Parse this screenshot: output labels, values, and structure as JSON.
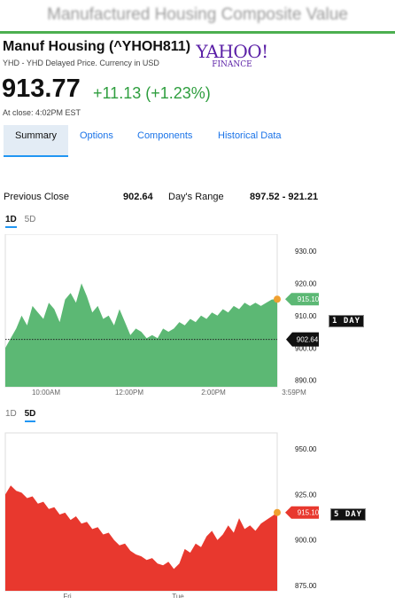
{
  "page_title": "Manufactured Housing Composite Value",
  "quote": {
    "name": "Manuf Housing (^YHOH811)",
    "subtitle": "YHD - YHD Delayed Price. Currency in USD",
    "price": "913.77",
    "change": "+11.13 (+1.23%)",
    "at_close": "At close: 4:02PM EST"
  },
  "logo": {
    "main": "YAHOO!",
    "sub": "FINANCE"
  },
  "tabs": [
    {
      "label": "Summary",
      "active": true
    },
    {
      "label": "Options",
      "active": false
    },
    {
      "label": "Components",
      "active": false
    },
    {
      "label": "Historical Data",
      "active": false
    }
  ],
  "stats": {
    "previous_close_label": "Previous Close",
    "previous_close_value": "902.64",
    "days_range_label": "Day's Range",
    "days_range_value": "897.52 - 921.21"
  },
  "colors": {
    "up": "#5cb874",
    "down": "#e8382e",
    "marker": "#f0a030",
    "accent": "#2196f3"
  },
  "chart_data": [
    {
      "type": "area",
      "range_toggle": {
        "options": [
          "1D",
          "5D"
        ],
        "active": "1D"
      },
      "badge": "1 DAY",
      "x_ticks": [
        "10:00AM",
        "12:00PM",
        "2:00PM",
        "3:59PM"
      ],
      "y_ticks": [
        "930.00",
        "920.00",
        "910.00",
        "900.00",
        "890.00"
      ],
      "ylim": [
        888,
        933
      ],
      "current_label": "915.10",
      "current_value": 915.1,
      "previous_close_label": "902.64",
      "previous_close_value": 902.64,
      "x": [
        0,
        0.02,
        0.04,
        0.06,
        0.08,
        0.1,
        0.12,
        0.14,
        0.16,
        0.18,
        0.2,
        0.22,
        0.24,
        0.26,
        0.28,
        0.3,
        0.32,
        0.34,
        0.36,
        0.38,
        0.4,
        0.42,
        0.44,
        0.46,
        0.48,
        0.5,
        0.52,
        0.54,
        0.56,
        0.58,
        0.6,
        0.62,
        0.64,
        0.66,
        0.68,
        0.7,
        0.72,
        0.74,
        0.76,
        0.78,
        0.8,
        0.82,
        0.84,
        0.86,
        0.88,
        0.9,
        0.92,
        0.94,
        0.96,
        0.98,
        1.0
      ],
      "values": [
        900,
        903,
        906,
        910,
        907,
        913,
        911,
        909,
        914,
        912,
        908,
        915,
        917,
        914,
        920,
        916,
        911,
        913,
        909,
        910,
        907,
        912,
        908,
        904,
        906,
        905,
        903,
        904,
        903,
        906,
        905,
        906,
        908,
        907,
        909,
        908,
        910,
        909,
        911,
        910,
        912,
        911,
        913,
        912,
        914,
        913,
        914,
        913,
        914,
        915,
        915.1
      ]
    },
    {
      "type": "area",
      "range_toggle": {
        "options": [
          "1D",
          "5D"
        ],
        "active": "5D"
      },
      "badge": "5 DAY",
      "x_ticks": [
        "Fri",
        "Tue"
      ],
      "y_ticks": [
        "950.00",
        "925.00",
        "900.00",
        "875.00"
      ],
      "ylim": [
        872,
        955
      ],
      "current_label": "915.10",
      "current_value": 915.1,
      "x": [
        0,
        0.02,
        0.04,
        0.06,
        0.08,
        0.1,
        0.12,
        0.14,
        0.16,
        0.18,
        0.2,
        0.22,
        0.24,
        0.26,
        0.28,
        0.3,
        0.32,
        0.34,
        0.36,
        0.38,
        0.4,
        0.42,
        0.44,
        0.46,
        0.48,
        0.5,
        0.52,
        0.54,
        0.56,
        0.58,
        0.6,
        0.62,
        0.64,
        0.66,
        0.68,
        0.7,
        0.72,
        0.74,
        0.76,
        0.78,
        0.8,
        0.82,
        0.84,
        0.86,
        0.88,
        0.9,
        0.92,
        0.94,
        0.96,
        0.98,
        1.0
      ],
      "values": [
        925,
        930,
        927,
        926,
        923,
        924,
        920,
        921,
        917,
        918,
        914,
        915,
        911,
        913,
        909,
        910,
        906,
        907,
        903,
        904,
        900,
        897,
        898,
        894,
        892,
        891,
        889,
        890,
        887,
        886,
        888,
        884,
        887,
        895,
        893,
        898,
        896,
        902,
        905,
        900,
        903,
        908,
        904,
        912,
        906,
        908,
        905,
        909,
        911,
        913,
        915.1
      ]
    }
  ]
}
